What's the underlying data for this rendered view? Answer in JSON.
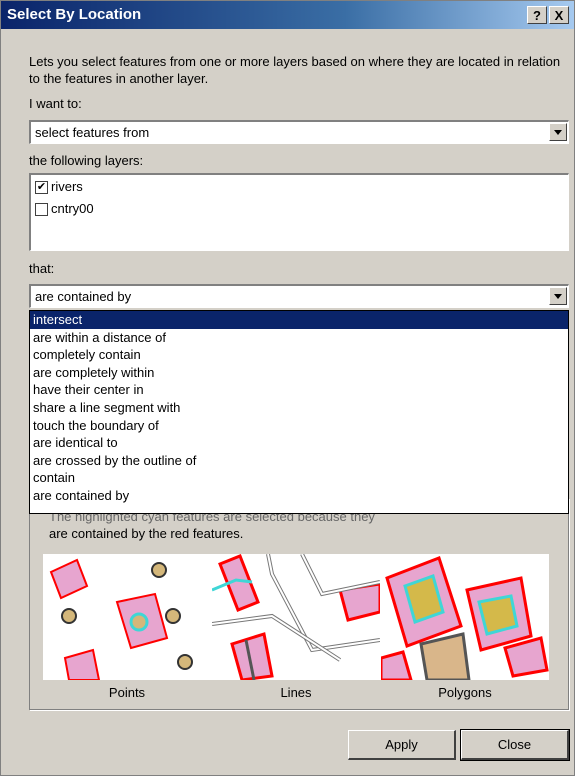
{
  "window": {
    "title": "Select By Location",
    "help_label": "?",
    "close_label": "X"
  },
  "description": "Lets you select features from one or more layers based on where they are located in relation to the features in another layer.",
  "i_want_to": {
    "label": "I want to:",
    "value": "select features from"
  },
  "layers": {
    "label": "the following layers:",
    "items": [
      {
        "name": "rivers",
        "checked": true,
        "mark": "✔"
      },
      {
        "name": "cntry00",
        "checked": false,
        "mark": ""
      }
    ]
  },
  "that": {
    "label": "that:",
    "value": "are contained by",
    "options": [
      "intersect",
      "are within a distance of",
      "completely contain",
      "are completely within",
      "have their center in",
      "share a line segment with",
      "touch the boundary of",
      "are identical to",
      "are crossed by the outline of",
      "contain",
      "are contained by"
    ],
    "highlighted_index": 0
  },
  "explanation": {
    "line1": "The highlighted cyan features are selected because they",
    "line2": "are contained by the red features."
  },
  "illustrations": [
    {
      "caption": "Points"
    },
    {
      "caption": "Lines"
    },
    {
      "caption": "Polygons"
    }
  ],
  "buttons": {
    "apply": "Apply",
    "close": "Close"
  },
  "colors": {
    "title_gradient_start": "#0a246a",
    "dialog_face": "#d4d0c8",
    "selection": "#0a246a",
    "feature_fill": "#e7a5cf",
    "feature_outline": "#ff0000",
    "selected_outline": "#3fd6d6",
    "point_fill": "#d4b77a"
  }
}
